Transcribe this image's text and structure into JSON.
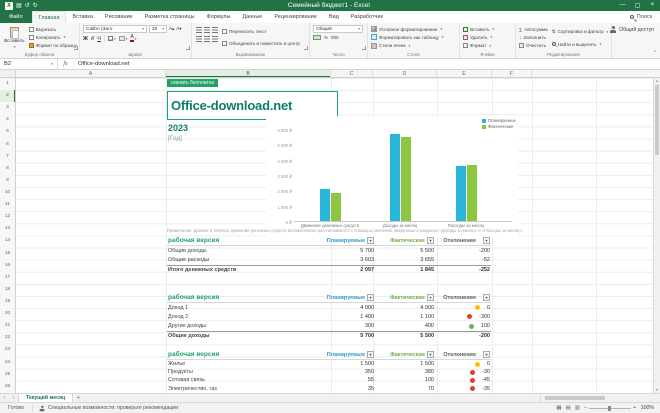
{
  "titlebar": {
    "title": "Семейный бюджет1 - Excel"
  },
  "ribbon": {
    "file_tab": "Файл",
    "tabs": [
      "Главная",
      "Вставка",
      "Рисование",
      "Разметка страницы",
      "Формулы",
      "Данные",
      "Рецензирование",
      "Вид",
      "Разработчик"
    ],
    "active_tab": "Главная",
    "search_label": "Поиск",
    "share_label": "Общий доступ",
    "clipboard": {
      "label": "Буфер обмена",
      "paste": "Вставить",
      "cut": "Вырезать",
      "copy": "Копировать",
      "painter": "Формат по образцу"
    },
    "font": {
      "label": "Шрифт",
      "name": "Calibri (Заго",
      "size": "20",
      "bold": "Ж",
      "italic": "К",
      "underline": "Ч"
    },
    "alignment": {
      "label": "Выравнивание",
      "wrap": "Переносить текст",
      "merge": "Объединить и поместить в центре"
    },
    "number": {
      "label": "Число",
      "format": "Общий",
      "percent": "%",
      "thousands": "000"
    },
    "styles": {
      "label": "Стили",
      "conditional": "Условное форматирование",
      "as_table": "Форматировать как таблицу",
      "cell_styles": "Стили ячеек"
    },
    "cells": {
      "label": "Ячейки",
      "insert": "Вставить",
      "delete": "Удалить",
      "format": "Формат"
    },
    "editing": {
      "label": "Редактирование",
      "autosum": "Автосумма",
      "fill": "Заполнить",
      "clear": "Очистить",
      "sort": "Сортировка и фильтр",
      "find": "Найти и выделить"
    }
  },
  "formula_bar": {
    "cell_ref": "B2",
    "value": "Office-download.net"
  },
  "grid": {
    "columns": [
      "A",
      "B",
      "C",
      "D",
      "E",
      "F"
    ],
    "row_count": 26,
    "selected_cell": "B2"
  },
  "sheet": {
    "promo_banner": "скачать бесплатно",
    "workbook_title": "Office-download.net",
    "year": "2023",
    "year_placeholder": "[Год]",
    "note": "Примечание. Данные в таблице движения денежных средств автоматически рассчитываются с помощью значений, введенных в разделах «Доходы за месяц» и «Расходы за месяц»."
  },
  "chart_data": {
    "type": "bar",
    "categories": [
      "Движение денежных средств",
      "Доходы за месяц",
      "Расходы за месяц"
    ],
    "series": [
      {
        "name": "Планируемые",
        "color": "#29b6d8",
        "values": [
          2097,
          5700,
          3603
        ]
      },
      {
        "name": "Фактические",
        "color": "#8dc63f",
        "values": [
          1845,
          5500,
          3655
        ]
      }
    ],
    "ytick_labels": [
      "6 000 ₽",
      "5 000 ₽",
      "4 000 ₽",
      "3 000 ₽",
      "2 000 ₽",
      "1 000 ₽",
      "0 ₽"
    ],
    "ylim": [
      0,
      6000
    ],
    "legend_position": "top-right",
    "grid": false
  },
  "tables": [
    {
      "title": "рабочая версия",
      "headers": [
        "Планируемые",
        "Фактические",
        "Отклонение"
      ],
      "rows": [
        {
          "label": "Общие доходы",
          "planned": "5 700",
          "actual": "5 500",
          "deviation": "-200",
          "dot": null,
          "total": false
        },
        {
          "label": "Общие расходы",
          "planned": "3 603",
          "actual": "3 655",
          "deviation": "-52",
          "dot": null,
          "total": false
        },
        {
          "label": "Итого денежных средств",
          "planned": "2 097",
          "actual": "1 845",
          "deviation": "-252",
          "dot": null,
          "total": true
        }
      ]
    },
    {
      "title": "рабочая версия",
      "headers": [
        "Планируемые",
        "Фактические",
        "Отклонение"
      ],
      "rows": [
        {
          "label": "Доход 1",
          "planned": "4 000",
          "actual": "4 000",
          "deviation": "0",
          "dot": "yellow",
          "total": false
        },
        {
          "label": "Доход 2",
          "planned": "1 400",
          "actual": "1 100",
          "deviation": "-300",
          "dot": "red",
          "total": false
        },
        {
          "label": "Другие доходы",
          "planned": "300",
          "actual": "400",
          "deviation": "100",
          "dot": "green",
          "total": false
        },
        {
          "label": "Общие доходы",
          "planned": "5 700",
          "actual": "5 500",
          "deviation": "-200",
          "dot": null,
          "total": true
        }
      ]
    },
    {
      "title": "рабочая версия",
      "headers": [
        "Планируемые",
        "Фактические",
        "Отклонение"
      ],
      "rows": [
        {
          "label": "Жилье",
          "planned": "1 500",
          "actual": "1 500",
          "deviation": "0",
          "dot": "yellow",
          "total": false
        },
        {
          "label": "Продукты",
          "planned": "350",
          "actual": "380",
          "deviation": "-30",
          "dot": "red",
          "total": false
        },
        {
          "label": "Сотовая связь",
          "planned": "55",
          "actual": "100",
          "deviation": "-45",
          "dot": "red",
          "total": false
        },
        {
          "label": "Электричество, газ",
          "planned": "35",
          "actual": "70",
          "deviation": "-35",
          "dot": "red",
          "total": false
        }
      ]
    }
  ],
  "sheet_tabs": {
    "active": "Текущий месяц",
    "add_label": "+"
  },
  "status_bar": {
    "mode": "Готово",
    "accessibility": "Специальные возможности: проверьте рекомендации",
    "zoom": "100%"
  },
  "colors": {
    "excel_green": "#217346",
    "site_teal": "#0f7d6c",
    "section_green": "#21a366",
    "header_blue": "#2e9ad0",
    "header_green": "#70ad47",
    "header_dark": "#595959",
    "chart_blue": "#29b6d8",
    "chart_green": "#8dc63f",
    "dot_green": "#5cb85c",
    "dot_yellow": "#ffc000",
    "dot_red": "#e03c31"
  }
}
